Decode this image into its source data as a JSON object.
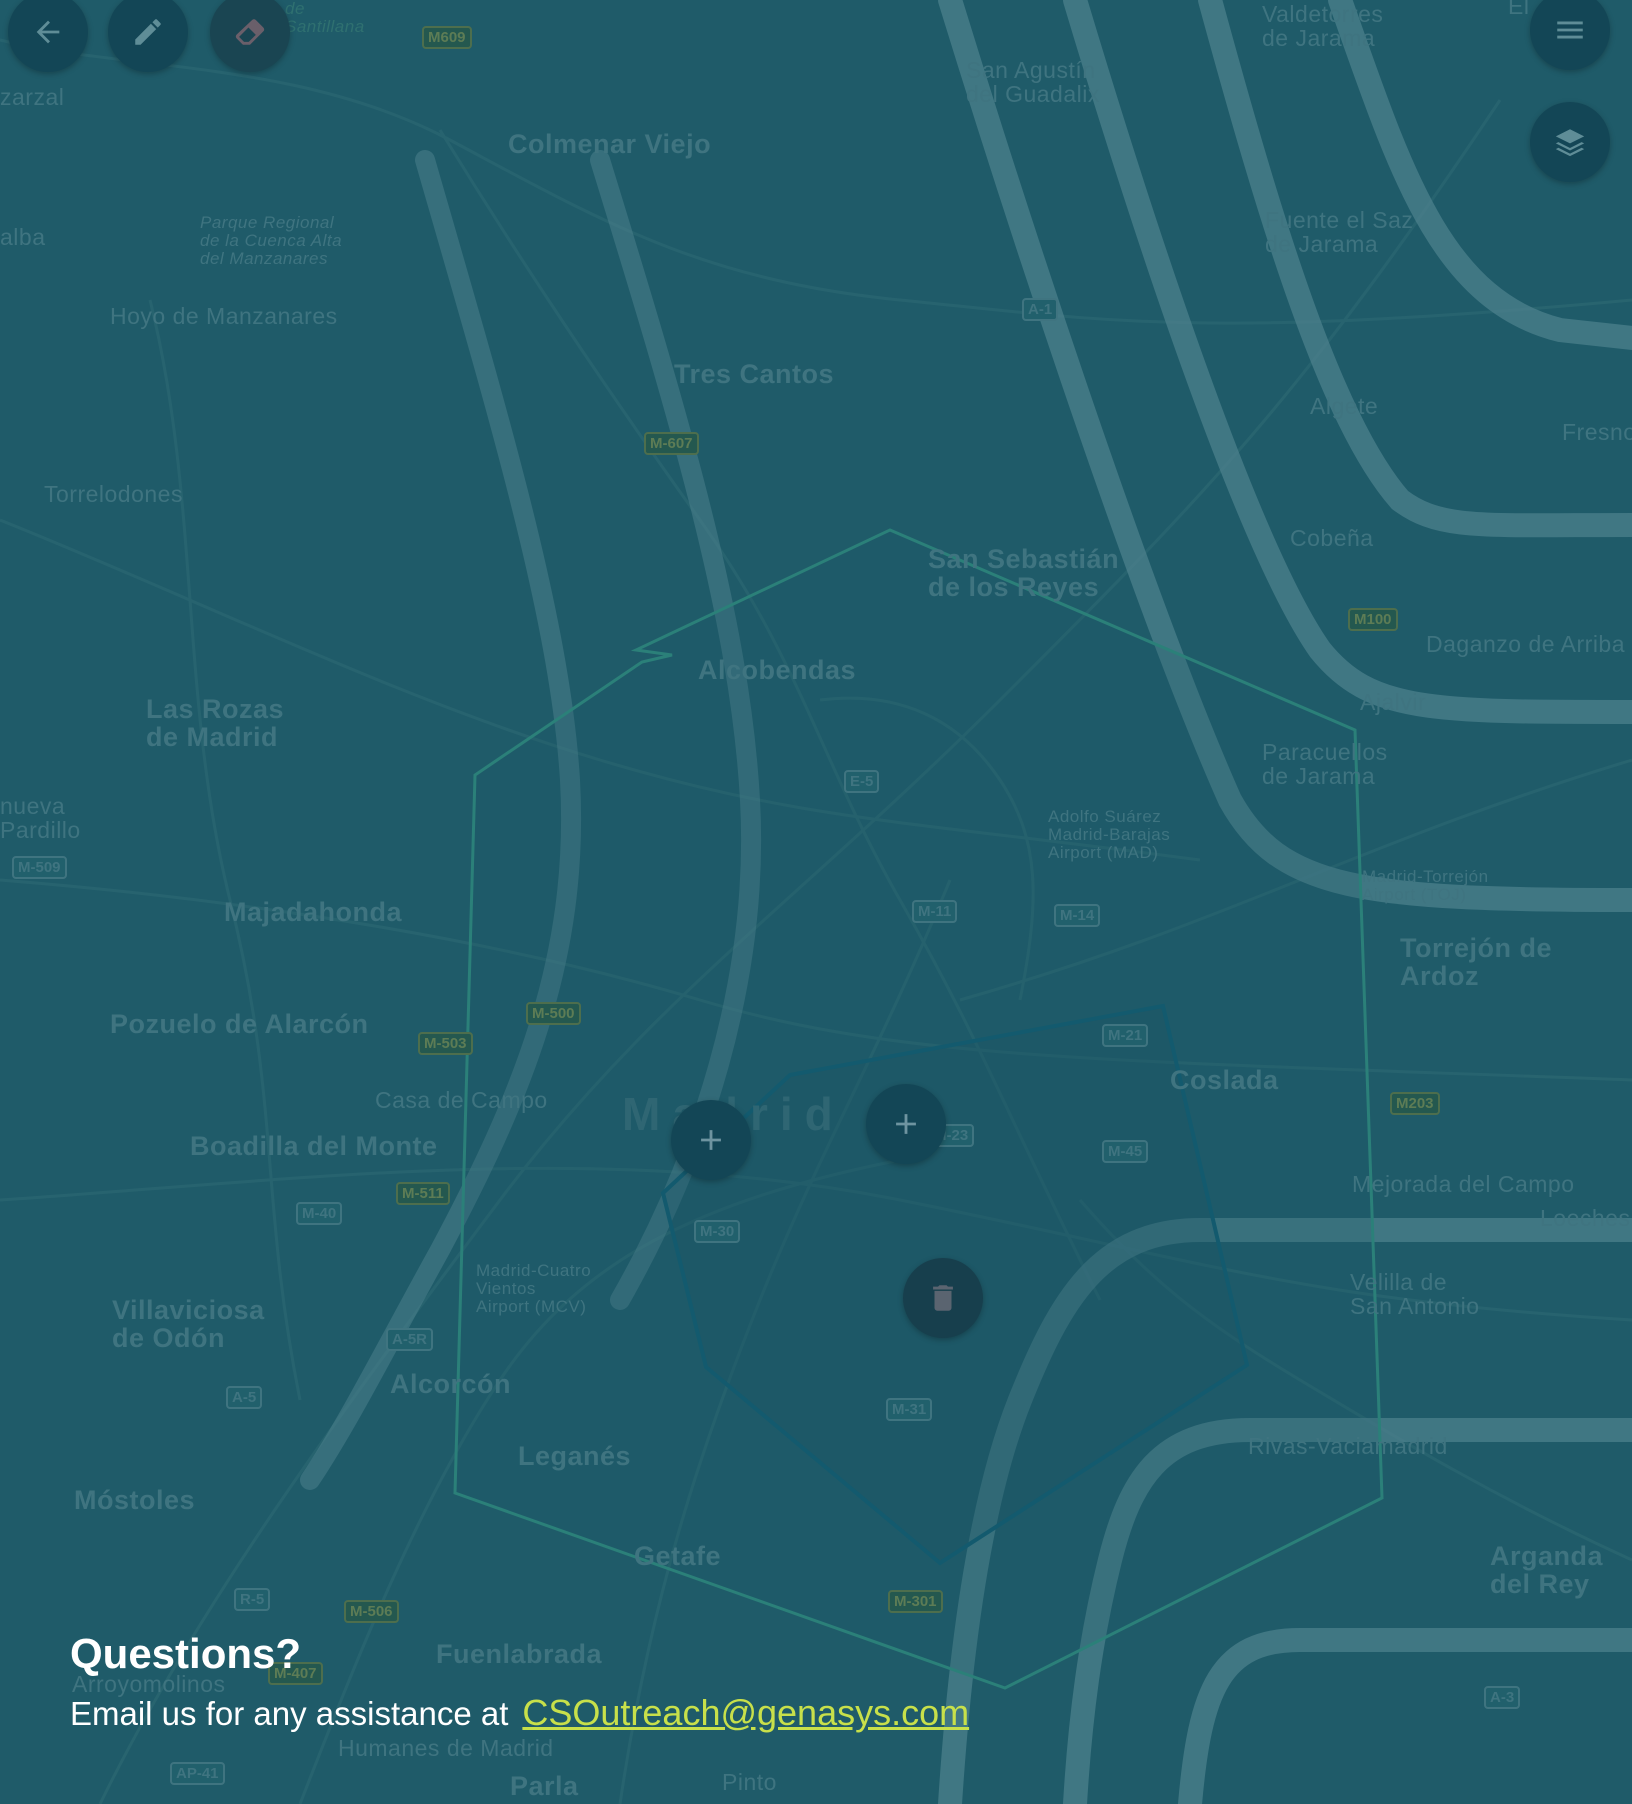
{
  "toolbar": {
    "back_icon": "arrow-left-icon",
    "edit_icon": "pencil-icon",
    "erase_icon": "eraser-icon",
    "menu_icon": "hamburger-menu-icon",
    "layers_icon": "layers-icon"
  },
  "map": {
    "places": [
      {
        "id": "real-de-santillana",
        "text": "Real\nde\nSantillana"
      },
      {
        "id": "valdetorres",
        "text": "Valdetorres\nde Jarama"
      },
      {
        "id": "el",
        "text": "El"
      },
      {
        "id": "zarzal",
        "text": "zarzal"
      },
      {
        "id": "san-agustin",
        "text": "San Agustín\ndel Guadalix"
      },
      {
        "id": "colmenar-viejo",
        "text": "Colmenar Viejo"
      },
      {
        "id": "alba",
        "text": "alba"
      },
      {
        "id": "parque-regional",
        "text": "Parque Regional\nde la Cuenca Alta\ndel Manzanares"
      },
      {
        "id": "fuente-el-saz",
        "text": "Fuente el Saz\nde Jarama"
      },
      {
        "id": "hoyo",
        "text": "Hoyo de Manzanares"
      },
      {
        "id": "tres-cantos",
        "text": "Tres Cantos"
      },
      {
        "id": "algete",
        "text": "Algete"
      },
      {
        "id": "fresno",
        "text": "Fresno"
      },
      {
        "id": "torrelodones",
        "text": "Torrelodones"
      },
      {
        "id": "cobena",
        "text": "Cobeña"
      },
      {
        "id": "san-sebastian",
        "text": "San Sebastián\nde los Reyes"
      },
      {
        "id": "daganzo",
        "text": "Daganzo de Arriba"
      },
      {
        "id": "alcobendas",
        "text": "Alcobendas"
      },
      {
        "id": "ajalvir",
        "text": "Ajalvir"
      },
      {
        "id": "las-rozas",
        "text": "Las Rozas\nde Madrid"
      },
      {
        "id": "paracuellos",
        "text": "Paracuellos\nde Jarama"
      },
      {
        "id": "villanueva",
        "text": "nueva\nPardillo"
      },
      {
        "id": "barajas",
        "text": "Adolfo Suárez\nMadrid-Barajas\nAirport (MAD)"
      },
      {
        "id": "torrejon-airport",
        "text": "Madrid-Torrejón\nAirport (TOJ)"
      },
      {
        "id": "majadahonda",
        "text": "Majadahonda"
      },
      {
        "id": "torrejon",
        "text": "Torrejón de Ardoz"
      },
      {
        "id": "pozuelo",
        "text": "Pozuelo de Alarcón"
      },
      {
        "id": "casa-de-campo",
        "text": "Casa de Campo"
      },
      {
        "id": "coslada",
        "text": "Coslada"
      },
      {
        "id": "madrid",
        "text": "Madrid"
      },
      {
        "id": "boadilla",
        "text": "Boadilla del Monte"
      },
      {
        "id": "mejorada",
        "text": "Mejorada del Campo"
      },
      {
        "id": "loeches",
        "text": "Loeches"
      },
      {
        "id": "cuatro-vientos",
        "text": "Madrid-Cuatro\nVientos\nAirport (MCV)"
      },
      {
        "id": "villaviciosa",
        "text": "Villaviciosa\nde Odón"
      },
      {
        "id": "velilla",
        "text": "Velilla de\nSan Antonio"
      },
      {
        "id": "alcorcon",
        "text": "Alcorcón"
      },
      {
        "id": "leganes",
        "text": "Leganés"
      },
      {
        "id": "rivas",
        "text": "Rivas-Vaciamadrid"
      },
      {
        "id": "mostoles",
        "text": "Móstoles"
      },
      {
        "id": "getafe",
        "text": "Getafe"
      },
      {
        "id": "arganda",
        "text": "Arganda del Rey"
      },
      {
        "id": "fuenlabrada",
        "text": "Fuenlabrada"
      },
      {
        "id": "arroyomolinos",
        "text": "Arroyomolinos"
      },
      {
        "id": "humanes",
        "text": "Humanes de Madrid"
      },
      {
        "id": "parla",
        "text": "Parla"
      },
      {
        "id": "pinto",
        "text": "Pinto"
      }
    ],
    "roads": [
      "M609",
      "A-1",
      "M-607",
      "M100",
      "E-5",
      "M-509",
      "M-11",
      "M-14",
      "M-500",
      "M-503",
      "M-21",
      "M203",
      "M-23",
      "M-45",
      "M-511",
      "M-40",
      "M-30",
      "A-5R",
      "M-31",
      "A-5",
      "R-5",
      "M-506",
      "M-301",
      "A-3",
      "AP-41",
      "M-407"
    ]
  },
  "map_controls": {
    "add_icon": "plus-icon",
    "delete_icon": "trash-icon"
  },
  "footer": {
    "heading": "Questions?",
    "text": "Email us for any assistance at",
    "email": "CSOutreach@genasys.com"
  },
  "colors": {
    "overlay": "#1f5b69",
    "button": "#134656",
    "link": "#c8e04a",
    "text": "#ffffff"
  }
}
